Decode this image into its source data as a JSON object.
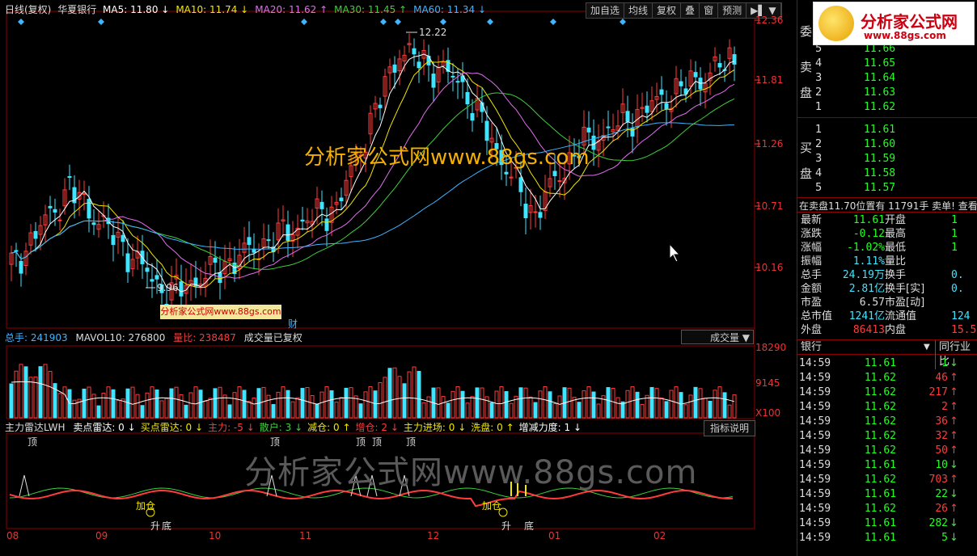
{
  "header": {
    "chart_mode": "日线(复权)",
    "stock_name": "华夏银行",
    "ma": [
      {
        "label": "MA5:",
        "value": "11.80",
        "arrow": "↓",
        "color": "#ffffff"
      },
      {
        "label": "MA10:",
        "value": "11.74",
        "arrow": "↓",
        "color": "#f2e600"
      },
      {
        "label": "MA20:",
        "value": "11.62",
        "arrow": "↑",
        "color": "#e36cf0"
      },
      {
        "label": "MA30:",
        "value": "11.45",
        "arrow": "↑",
        "color": "#3ccf3c"
      },
      {
        "label": "MA60:",
        "value": "11.34",
        "arrow": "↓",
        "color": "#3fb4ff"
      }
    ],
    "buttons": [
      "加自选",
      "均线",
      "复权",
      "叠",
      "窗",
      "预测"
    ],
    "extra_icon": "▶▌ ▼"
  },
  "price_axis": {
    "labels": [
      "12.36",
      "11.81",
      "11.26",
      "10.71",
      "10.16"
    ]
  },
  "annotations": {
    "high": "12.22",
    "low": "9.96",
    "cai": "财"
  },
  "watermarks": {
    "big": "分析家公式网www.88gs.com",
    "mid": "分析家公式网www.88gs.com",
    "small": "分析家公式网www.88gs.com",
    "logo_title": "分析家公式网",
    "logo_url": "www.88gs.com"
  },
  "volume_header": {
    "total": "总手: 241903",
    "mavol": "MAVOL10: 276800",
    "ratio": "量比: 238487",
    "note": "成交量已复权",
    "dropdown": "成交量 ▼",
    "axis": [
      "18290",
      "9145",
      "X100"
    ]
  },
  "indicator_header": {
    "name": "主力雷达LWH",
    "items": [
      {
        "text": "卖点雷达: 0",
        "arrow": "↓",
        "color": "#ffffff"
      },
      {
        "text": "买点雷达: 0",
        "arrow": "↓",
        "color": "#f2e600"
      },
      {
        "text": "主力: -5",
        "arrow": "↓",
        "color": "#ff3b3b"
      },
      {
        "text": "散户: 3",
        "arrow": "↓",
        "color": "#3ccf3c"
      },
      {
        "text": "减仓: 0",
        "arrow": "↑",
        "color": "#f2e600"
      },
      {
        "text": "增仓: 2",
        "arrow": "↓",
        "color": "#ff3b3b"
      },
      {
        "text": "主力进场: 0",
        "arrow": "↓",
        "color": "#f2e600"
      },
      {
        "text": "洗盘: 0",
        "arrow": "↑",
        "color": "#f2e600"
      },
      {
        "text": "增减力度: 1",
        "arrow": "↓",
        "color": "#ffffff"
      }
    ],
    "button": "指标说明",
    "top_labels": [
      "顶",
      "顶",
      "顶",
      "顶",
      "顶"
    ],
    "bottom_labels": [
      "加仓",
      "升",
      "底",
      "加仓",
      "升",
      "底"
    ]
  },
  "x_axis": [
    "08",
    "09",
    "10",
    "11",
    "12",
    "01",
    "02"
  ],
  "orderbook": {
    "sell_label": [
      "委",
      "卖",
      "盘"
    ],
    "buy_label": [
      "买",
      "盘"
    ],
    "sell": [
      {
        "n": "5",
        "p": "11.66"
      },
      {
        "n": "4",
        "p": "11.65"
      },
      {
        "n": "3",
        "p": "11.64"
      },
      {
        "n": "2",
        "p": "11.63"
      },
      {
        "n": "1",
        "p": "11.62"
      }
    ],
    "buy": [
      {
        "n": "1",
        "p": "11.61"
      },
      {
        "n": "2",
        "p": "11.60"
      },
      {
        "n": "3",
        "p": "11.59"
      },
      {
        "n": "4",
        "p": "11.58"
      },
      {
        "n": "5",
        "p": "11.57"
      }
    ],
    "notice": "在卖盘11.70位置有 11791手 卖单! 查看"
  },
  "stats": [
    {
      "l": "最新",
      "v": "11.61",
      "vc": "#2f2",
      "l2": "开盘",
      "v2": "1"
    },
    {
      "l": "涨跌",
      "v": "-0.12",
      "vc": "#2f2",
      "l2": "最高",
      "v2": "1"
    },
    {
      "l": "涨幅",
      "v": "-1.02%",
      "vc": "#2f2",
      "l2": "最低",
      "v2": "1"
    },
    {
      "l": "振幅",
      "v": "1.11%",
      "vc": "#3fe4ff",
      "l2": "量比",
      "v2": ""
    },
    {
      "l": "总手",
      "v": "24.19万",
      "vc": "#3fe4ff",
      "l2": "换手",
      "v2": "0."
    },
    {
      "l": "金额",
      "v": "2.81亿",
      "vc": "#3fe4ff",
      "l2": "换手[实]",
      "v2": "0."
    },
    {
      "l": "市盈",
      "v": "6.57",
      "vc": "#ddd",
      "l2": "市盈[动]",
      "v2": ""
    },
    {
      "l": "总市值",
      "v": "1241亿",
      "vc": "#3fe4ff",
      "l2": "流通值",
      "v2": "124"
    },
    {
      "l": "外盘",
      "v": "86413",
      "vc": "#ff3b3b",
      "l2": "内盘",
      "v2": "15.5"
    }
  ],
  "ticks_header": {
    "sector": "银行",
    "sector_arrow": "▼",
    "peer": "同行业比"
  },
  "ticks": [
    {
      "t": "14:59",
      "p": "11.61",
      "pc": "#2f2",
      "v": "1",
      "a": "↓",
      "ac": "#2f2"
    },
    {
      "t": "14:59",
      "p": "11.62",
      "pc": "#2f2",
      "v": "46",
      "a": "↑",
      "ac": "#ff3b3b"
    },
    {
      "t": "14:59",
      "p": "11.62",
      "pc": "#2f2",
      "v": "217",
      "a": "↑",
      "ac": "#ff3b3b"
    },
    {
      "t": "14:59",
      "p": "11.62",
      "pc": "#2f2",
      "v": "2",
      "a": "↑",
      "ac": "#ff3b3b"
    },
    {
      "t": "14:59",
      "p": "11.62",
      "pc": "#2f2",
      "v": "36",
      "a": "↑",
      "ac": "#ff3b3b"
    },
    {
      "t": "14:59",
      "p": "11.62",
      "pc": "#2f2",
      "v": "32",
      "a": "↑",
      "ac": "#ff3b3b"
    },
    {
      "t": "14:59",
      "p": "11.62",
      "pc": "#2f2",
      "v": "50",
      "a": "↑",
      "ac": "#ff3b3b"
    },
    {
      "t": "14:59",
      "p": "11.61",
      "pc": "#2f2",
      "v": "10",
      "a": "↓",
      "ac": "#2f2"
    },
    {
      "t": "14:59",
      "p": "11.62",
      "pc": "#2f2",
      "v": "703",
      "a": "↑",
      "ac": "#ff3b3b"
    },
    {
      "t": "14:59",
      "p": "11.61",
      "pc": "#2f2",
      "v": "22",
      "a": "↓",
      "ac": "#2f2"
    },
    {
      "t": "14:59",
      "p": "11.62",
      "pc": "#2f2",
      "v": "26",
      "a": "↑",
      "ac": "#ff3b3b"
    },
    {
      "t": "14:59",
      "p": "11.61",
      "pc": "#2f2",
      "v": "282",
      "a": "↓",
      "ac": "#2f2"
    },
    {
      "t": "14:59",
      "p": "11.61",
      "pc": "#2f2",
      "v": "5",
      "a": "↓",
      "ac": "#2f2"
    }
  ]
}
